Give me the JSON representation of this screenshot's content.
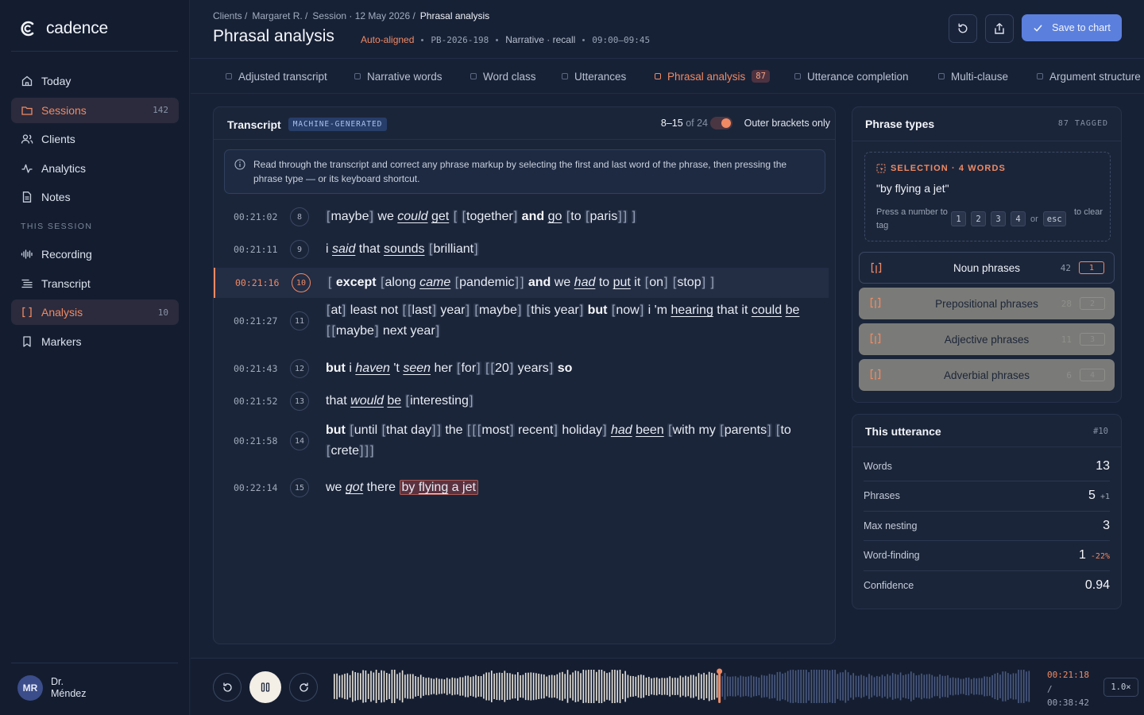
{
  "app": {
    "name": "cadence"
  },
  "sidebar": {
    "items": [
      {
        "label": "Today",
        "icon": "home-icon"
      },
      {
        "label": "Sessions",
        "icon": "folder-icon",
        "count": "142",
        "active": true
      },
      {
        "label": "Clients",
        "icon": "users-icon"
      },
      {
        "label": "Analytics",
        "icon": "activity-icon"
      },
      {
        "label": "Notes",
        "icon": "document-icon"
      }
    ],
    "section_label": "THIS SESSION",
    "session_items": [
      {
        "label": "Recording",
        "icon": "waveform-icon"
      },
      {
        "label": "Transcript",
        "icon": "text-lines-icon"
      },
      {
        "label": "Analysis",
        "icon": "brackets-icon",
        "count": "10",
        "active": true
      },
      {
        "label": "Markers",
        "icon": "bookmark-icon"
      }
    ],
    "user": {
      "initials": "MR",
      "name": "Dr. Méndez"
    }
  },
  "header": {
    "breadcrumbs": [
      "Clients /",
      "Margaret R. /",
      "Session · 12 May 2026 /",
      "Phrasal analysis"
    ],
    "title": "Phrasal analysis",
    "status": "Auto-aligned",
    "code": "PB-2026-198",
    "task": "Narrative · recall",
    "time_range": "09:00–09:45",
    "save_label": "Save to chart"
  },
  "tabs": [
    {
      "label": "Adjusted transcript"
    },
    {
      "label": "Narrative words"
    },
    {
      "label": "Word class"
    },
    {
      "label": "Utterances"
    },
    {
      "label": "Phrasal analysis",
      "badge": "87",
      "active": true
    },
    {
      "label": "Utterance completion"
    },
    {
      "label": "Multi-clause"
    },
    {
      "label": "Argument structure"
    }
  ],
  "transcript": {
    "title": "Transcript",
    "badge": "MACHINE-GENERATED",
    "range": "8–15",
    "of": "of 24",
    "toggle_label": "Outer brackets only",
    "info": "Read through the transcript and correct any phrase markup by selecting the first and last word of the phrase, then pressing the phrase type — or its keyboard shortcut.",
    "rows": [
      {
        "time": "00:21:02",
        "num": "8",
        "html": "<span class=\"br\">[</span>maybe<span class=\"br\">]</span> we <span class=\"iu\">could</span> <span class=\"u\">get</span> <span class=\"br\">[</span> <span class=\"br\">[</span>together<span class=\"br\">]</span> <b>and</b> <span class=\"u\">go</span> <span class=\"br\">[</span>to <span class=\"br\">[</span>paris<span class=\"br\">]</span><span class=\"br\">]</span> <span class=\"br\">]</span>"
      },
      {
        "time": "00:21:11",
        "num": "9",
        "html": "i <span class=\"iu\">said</span> that <span class=\"u\">sounds</span> <span class=\"br\">[</span>brilliant<span class=\"br\">]</span>"
      },
      {
        "time": "00:21:16",
        "num": "10",
        "current": true,
        "html": "<span class=\"br\">[</span> <b>except</b> <span class=\"br\">[</span>along <span class=\"iu\">came</span> <span class=\"br\">[</span>pandemic<span class=\"br\">]</span><span class=\"br\">]</span> <b>and</b> we <span class=\"iu\">had</span> to <span class=\"u\">put</span> it <span class=\"br\">[</span>on<span class=\"br\">]</span> <span class=\"br\">[</span>stop<span class=\"br\">]</span> <span class=\"br\">]</span>"
      },
      {
        "time": "00:21:27",
        "num": "11",
        "html": "<span class=\"br\">[</span>at<span class=\"br\">]</span> least not <span class=\"br\">[</span><span class=\"br\">[</span>last<span class=\"br\">]</span> year<span class=\"br\">]</span> <span class=\"br\">[</span>maybe<span class=\"br\">]</span> <span class=\"br\">[</span>this year<span class=\"br\">]</span> <b>but</b> <span class=\"br\">[</span>now<span class=\"br\">]</span> i 'm <span class=\"u\">hearing</span> that it <span class=\"u\">could</span> <span class=\"u\">be</span> <span class=\"br\">[</span><span class=\"br\">[</span>maybe<span class=\"br\">]</span> next year<span class=\"br\">]</span>"
      },
      {
        "time": "00:21:43",
        "num": "12",
        "html": "<b>but</b> i <span class=\"iu\">haven</span> 't <span class=\"iu\">seen</span> her <span class=\"br\">[</span>for<span class=\"br\">]</span> <span class=\"br\">[</span><span class=\"br\">[</span>20<span class=\"br\">]</span> years<span class=\"br\">]</span> <b>so</b>"
      },
      {
        "time": "00:21:52",
        "num": "13",
        "html": "that <span class=\"iu\">would</span> <span class=\"u\">be</span> <span class=\"br\">[</span>interesting<span class=\"br\">]</span>"
      },
      {
        "time": "00:21:58",
        "num": "14",
        "html": "<b>but</b> <span class=\"br\">[</span>until <span class=\"br\">[</span>that day<span class=\"br\">]</span><span class=\"br\">]</span> the <span class=\"br\">[</span><span class=\"br\">[</span><span class=\"br\">[</span>most<span class=\"br\">]</span> recent<span class=\"br\">]</span> holiday<span class=\"br\">]</span> <span class=\"iu\">had</span> <span class=\"u\">been</span> <span class=\"br\">[</span>with my <span class=\"br\">[</span>parents<span class=\"br\">]</span> <span class=\"br\">[</span>to <span class=\"br\">[</span>crete<span class=\"br\">]</span><span class=\"br\">]</span><span class=\"br\">]</span>"
      },
      {
        "time": "00:22:14",
        "num": "15",
        "html": "we <span class=\"iu\">got</span> there <span class=\"sel\">by <span class=\"u\">flying</span> a jet</span>"
      }
    ]
  },
  "phrase_types": {
    "title": "Phrase types",
    "count_label": "87 TAGGED",
    "selection_label": "SELECTION · 4 WORDS",
    "selection_text": "\"by flying a jet\"",
    "hint_pre": "Press a number to tag",
    "keys": [
      "1",
      "2",
      "3",
      "4"
    ],
    "or": "or",
    "esc": "esc",
    "hint_post": "to clear",
    "types": [
      {
        "label": "Noun phrases",
        "count": "42",
        "key": "1",
        "state": "on"
      },
      {
        "label": "Prepositional phrases",
        "count": "28",
        "key": "2",
        "state": "off"
      },
      {
        "label": "Adjective phrases",
        "count": "11",
        "key": "3",
        "state": "off"
      },
      {
        "label": "Adverbial phrases",
        "count": "6",
        "key": "4",
        "state": "off"
      }
    ],
    "colors": {
      "on": "#f08a64",
      "off": "#7a7b78"
    }
  },
  "utterance": {
    "title": "This utterance",
    "id": "#10",
    "stats": [
      {
        "label": "Words",
        "value": "13",
        "delta": ""
      },
      {
        "label": "Phrases",
        "value": "5",
        "delta": "+1",
        "delta_color": "#9aa4b6"
      },
      {
        "label": "Max nesting",
        "value": "3",
        "delta": ""
      },
      {
        "label": "Word-finding",
        "value": "1",
        "delta": "-22%",
        "delta_color": "#f08a64"
      },
      {
        "label": "Confidence",
        "value": "0.94",
        "delta": ""
      }
    ]
  },
  "player": {
    "current": "00:21:18",
    "sep": "/",
    "total": "00:38:42",
    "speed": "1.0×",
    "progress": 0.553,
    "colors": {
      "played": "#e9e4dc",
      "unplayed": "#4a5a82",
      "cursor": "#f08a64"
    }
  }
}
